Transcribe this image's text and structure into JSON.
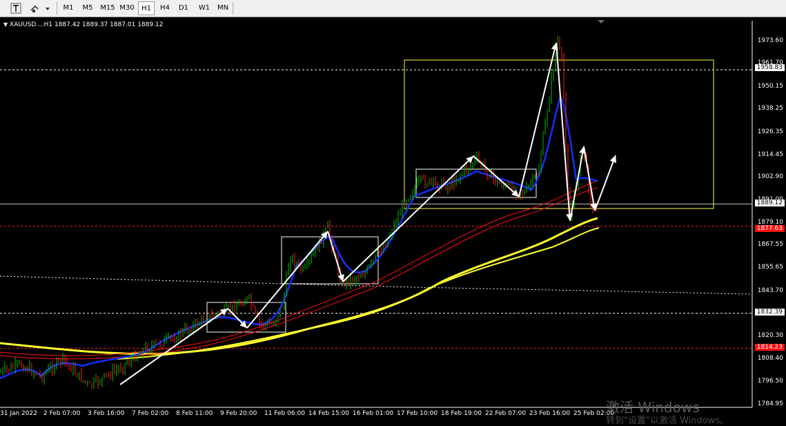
{
  "toolbar": {
    "crosshair_icon": "crosshair-icon",
    "drawing_tools_icon": "drawing-tools-icon",
    "timeframes": [
      "M1",
      "M5",
      "M15",
      "M30",
      "H1",
      "H4",
      "D1",
      "W1",
      "MN"
    ],
    "active_timeframe": "H1"
  },
  "chart": {
    "symbol_text": "XAUUSD....H1  1887.42 1889.37 1887.01 1889.12",
    "price_labels": [
      "1973.60",
      "1961.70",
      "1950.15",
      "1938.25",
      "1926.35",
      "1914.45",
      "1902.90",
      "1891.00",
      "1879.10",
      "1867.55",
      "1855.65",
      "1843.70",
      "1832.30",
      "1820.30",
      "1808.40",
      "1796.50",
      "1784.95"
    ],
    "current_price": "1889.12",
    "level_labels": {
      "level_1958": "1958.83",
      "level_1877": "1877.63",
      "level_1832": "1832.39",
      "level_1814": "1814.23"
    },
    "time_labels": [
      "31 Jan 2022",
      "2 Feb 07:00",
      "3 Feb 16:00",
      "7 Feb 02:00",
      "8 Feb 11:00",
      "9 Feb 20:00",
      "11 Feb 06:00",
      "14 Feb 15:00",
      "16 Feb 01:00",
      "17 Feb 10:00",
      "18 Feb 19:00",
      "22 Feb 07:00",
      "23 Feb 16:00",
      "25 Feb 02:00"
    ],
    "colors": {
      "background": "#000000",
      "bull": "#00c000",
      "bear": "#ff2020",
      "ma_blue": "#1030ff",
      "ma_yellow": "#ffff30",
      "ma_red": "#ff1010",
      "box_white": "#ffffff",
      "box_yellow": "#ffff40",
      "arrow": "#ffffff",
      "level_red": "#ff2020"
    }
  },
  "watermark": {
    "line1": "激活 Windows",
    "line2": "转到\"设置\"以激活 Windows。"
  }
}
